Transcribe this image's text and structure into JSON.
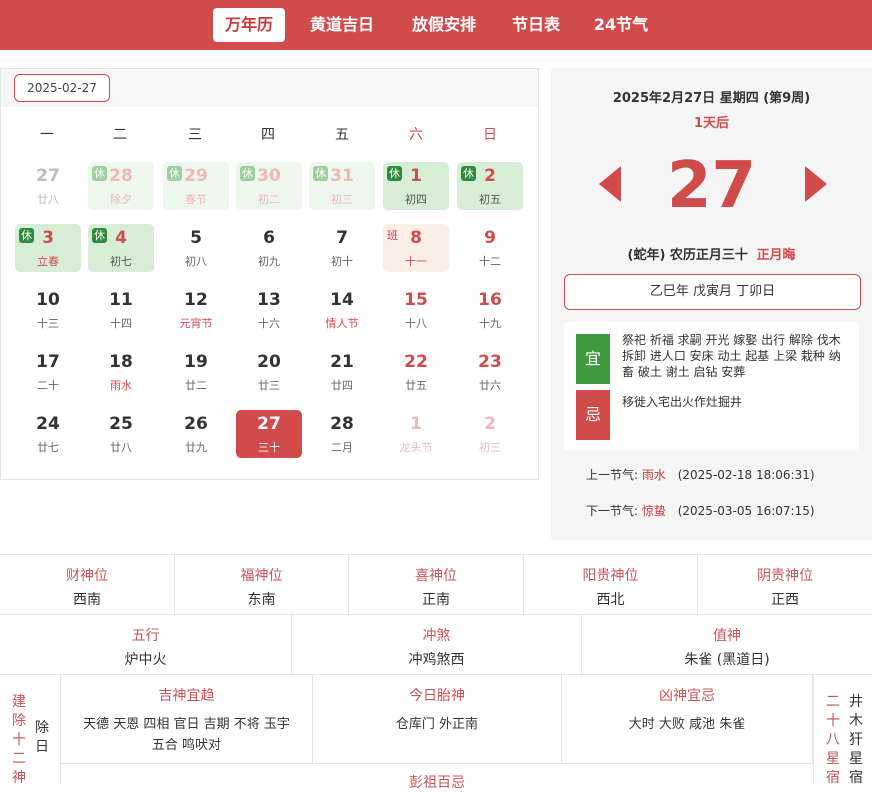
{
  "nav": [
    {
      "label": "万年历",
      "active": true
    },
    {
      "label": "黄道吉日",
      "active": false
    },
    {
      "label": "放假安排",
      "active": false
    },
    {
      "label": "节日表",
      "active": false
    },
    {
      "label": "24节气",
      "active": false
    }
  ],
  "calendar": {
    "date_input": "2025-02-27",
    "weekdays": [
      "一",
      "二",
      "三",
      "四",
      "五",
      "六",
      "日"
    ],
    "holiday_tag": "休",
    "work_tag": "班",
    "days": [
      {
        "day": "27",
        "lunar": "廿八",
        "style": "dim"
      },
      {
        "day": "28",
        "lunar": "除夕",
        "style": "hol dim",
        "tag": "休"
      },
      {
        "day": "29",
        "lunar": "春节",
        "style": "hol dim",
        "tag": "休"
      },
      {
        "day": "30",
        "lunar": "初二",
        "style": "hol dim",
        "tag": "休"
      },
      {
        "day": "31",
        "lunar": "初三",
        "style": "hol dim",
        "tag": "休"
      },
      {
        "day": "1",
        "lunar": "初四",
        "style": "hol ink",
        "tag": "休"
      },
      {
        "day": "2",
        "lunar": "初五",
        "style": "hol ink",
        "tag": "休"
      },
      {
        "day": "3",
        "lunar": "立春",
        "style": "hol redl",
        "tag": "休"
      },
      {
        "day": "4",
        "lunar": "初七",
        "style": "hol ink",
        "tag": "休"
      },
      {
        "day": "5",
        "lunar": "初八",
        "style": ""
      },
      {
        "day": "6",
        "lunar": "初九",
        "style": ""
      },
      {
        "day": "7",
        "lunar": "初十",
        "style": ""
      },
      {
        "day": "8",
        "lunar": "十一",
        "style": "work",
        "tag": "班"
      },
      {
        "day": "9",
        "lunar": "十二",
        "style": "redd"
      },
      {
        "day": "10",
        "lunar": "十三",
        "style": ""
      },
      {
        "day": "11",
        "lunar": "十四",
        "style": ""
      },
      {
        "day": "12",
        "lunar": "元宵节",
        "style": "redl"
      },
      {
        "day": "13",
        "lunar": "十六",
        "style": ""
      },
      {
        "day": "14",
        "lunar": "情人节",
        "style": "redl"
      },
      {
        "day": "15",
        "lunar": "十八",
        "style": "redd"
      },
      {
        "day": "16",
        "lunar": "十九",
        "style": "redd"
      },
      {
        "day": "17",
        "lunar": "二十",
        "style": ""
      },
      {
        "day": "18",
        "lunar": "雨水",
        "style": "redl"
      },
      {
        "day": "19",
        "lunar": "廿二",
        "style": ""
      },
      {
        "day": "20",
        "lunar": "廿三",
        "style": ""
      },
      {
        "day": "21",
        "lunar": "廿四",
        "style": ""
      },
      {
        "day": "22",
        "lunar": "廿五",
        "style": "redd"
      },
      {
        "day": "23",
        "lunar": "廿六",
        "style": "redd"
      },
      {
        "day": "24",
        "lunar": "廿七",
        "style": ""
      },
      {
        "day": "25",
        "lunar": "廿八",
        "style": ""
      },
      {
        "day": "26",
        "lunar": "廿九",
        "style": ""
      },
      {
        "day": "27",
        "lunar": "三十",
        "style": "today"
      },
      {
        "day": "28",
        "lunar": "二月",
        "style": ""
      },
      {
        "day": "1",
        "lunar": "龙头节",
        "style": "fadered"
      },
      {
        "day": "2",
        "lunar": "初三",
        "style": "fadered"
      }
    ]
  },
  "detail": {
    "header": "2025年2月27日 星期四 (第9周)",
    "relative": "1天后",
    "big_day": "27",
    "lunar_prefix": "(蛇年) 农历正月三十",
    "lunar_tag": "正月晦",
    "ganzhi": "乙巳年 戊寅月 丁卯日",
    "yi_label": "宜",
    "yi_text": "祭祀 祈福 求嗣 开光 嫁娶 出行 解除 伐木 拆卸 进人口 安床 动土 起基 上梁 栽种 纳畜 破土 谢土 启钻 安葬",
    "ji_label": "忌",
    "ji_text": "移徙入宅出火作灶掘井",
    "prev_jieqi_label": "上一节气:",
    "prev_jieqi_name": "雨水",
    "prev_jieqi_time": "(2025-02-18 18:06:31)",
    "next_jieqi_label": "下一节气:",
    "next_jieqi_name": "惊蛰",
    "next_jieqi_time": "(2025-03-05 16:07:15)",
    "colors": {
      "accent": "#d24b4b",
      "yi": "#2e8b3c",
      "holiday_bg": "#d8edd6"
    }
  },
  "gods_row": [
    {
      "title": "财神位",
      "value": "西南"
    },
    {
      "title": "福神位",
      "value": "东南"
    },
    {
      "title": "喜神位",
      "value": "正南"
    },
    {
      "title": "阳贵神位",
      "value": "西北"
    },
    {
      "title": "阴贵神位",
      "value": "正西"
    }
  ],
  "elements_row": [
    {
      "title": "五行",
      "value": "炉中火"
    },
    {
      "title": "冲煞",
      "value": "冲鸡煞西"
    },
    {
      "title": "值神",
      "value": "朱雀 (黑道日)"
    }
  ],
  "bottom": {
    "jianchu_label": "建除十二神",
    "jianchu_value": "除日",
    "jishen_title": "吉神宜趋",
    "jishen_value1": "天德 天恩 四相 官日 吉期 不将 玉宇",
    "jishen_value2": "五合 鸣吠对",
    "taishen_title": "今日胎神",
    "taishen_value": "仓库门 外正南",
    "xiongshen_title": "凶神宜忌",
    "xiongshen_value": "大时 大败 咸池 朱雀",
    "xiu_label": "二十八星宿",
    "xiu_value": "井木犴星宿",
    "pengzu_title": "彭祖百忌"
  }
}
